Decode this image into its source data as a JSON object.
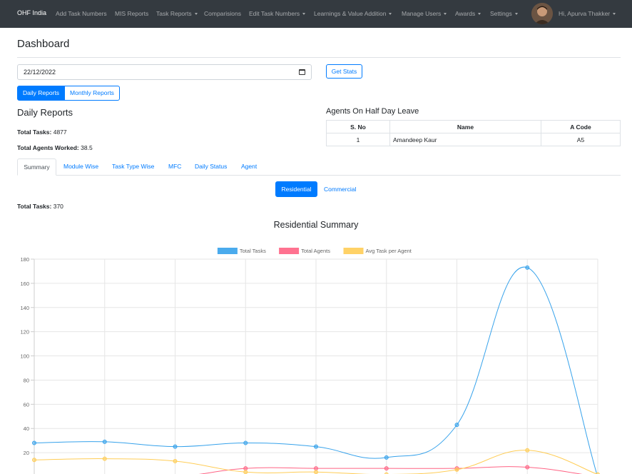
{
  "navbar": {
    "brand": "OHF India",
    "items": [
      {
        "label": "Add Task Numbers",
        "dropdown": false
      },
      {
        "label": "MIS Reports",
        "dropdown": false
      },
      {
        "label": "Task Reports",
        "dropdown": true
      },
      {
        "label": "Comparisions",
        "dropdown": false
      },
      {
        "label": "Edit Task Numbers",
        "dropdown": true
      },
      {
        "label": "Learnings & Value Addition",
        "dropdown": true
      },
      {
        "label": "Manage Users",
        "dropdown": true
      },
      {
        "label": "Awards",
        "dropdown": true
      },
      {
        "label": "Settings",
        "dropdown": true
      }
    ],
    "user_greeting": "Hi, Apurva Thakker"
  },
  "page": {
    "title": "Dashboard",
    "date_value": "22/12/2022",
    "get_stats_label": "Get Stats",
    "report_toggle": {
      "daily": "Daily Reports",
      "monthly": "Monthly Reports",
      "active": "daily"
    }
  },
  "daily": {
    "heading": "Daily Reports",
    "total_tasks_label": "Total Tasks:",
    "total_tasks_value": "4877",
    "total_agents_label": "Total Agents Worked:",
    "total_agents_value": "38.5"
  },
  "leave": {
    "heading": "Agents On Half Day Leave",
    "columns": [
      "S. No",
      "Name",
      "A Code"
    ],
    "rows": [
      [
        "1",
        "Amandeep Kaur",
        "A5"
      ]
    ]
  },
  "tabs": [
    "Summary",
    "Module Wise",
    "Task Type Wise",
    "MFC",
    "Daily Status",
    "Agent"
  ],
  "summary": {
    "residential_label": "Residential",
    "commercial_label": "Commercial",
    "total_tasks_label": "Total Tasks:",
    "total_tasks_value": "370"
  },
  "chart_data": {
    "type": "line",
    "title": "Residential Summary",
    "ylim": [
      0,
      180
    ],
    "yticks": [
      20,
      40,
      60,
      80,
      100,
      120,
      140,
      160,
      180
    ],
    "grid": true,
    "legend_position": "top-center",
    "series": [
      {
        "name": "Total Tasks",
        "color": "#36a2eb",
        "values": [
          28,
          29,
          25,
          28,
          25,
          16,
          43,
          173,
          0
        ]
      },
      {
        "name": "Total Agents",
        "color": "#ff6384",
        "values": [
          0,
          0,
          0,
          7,
          7,
          7,
          7,
          8,
          0
        ]
      },
      {
        "name": "Avg Task per Agent",
        "color": "#ffcd56",
        "values": [
          14,
          15,
          13,
          4,
          4,
          2,
          6,
          22,
          2
        ]
      }
    ]
  },
  "colors": {
    "navbar_bg": "#343a40",
    "primary": "#007bff"
  }
}
